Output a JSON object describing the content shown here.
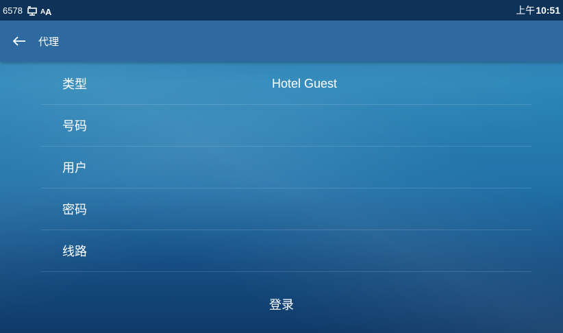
{
  "status": {
    "ext": "6578",
    "time_ampm": "上午",
    "time": "10:51"
  },
  "header": {
    "title": "代理"
  },
  "fields": [
    {
      "label": "类型",
      "value": "Hotel Guest"
    },
    {
      "label": "号码",
      "value": ""
    },
    {
      "label": "用户",
      "value": ""
    },
    {
      "label": "密码",
      "value": ""
    },
    {
      "label": "线路",
      "value": ""
    }
  ],
  "login_label": "登录",
  "colors": {
    "statusbar": "#0e3258",
    "titlebar": "#2e6aa0",
    "text": "#ffffff"
  },
  "icons": [
    "network-icon",
    "font-size-icon",
    "back-arrow-icon"
  ]
}
